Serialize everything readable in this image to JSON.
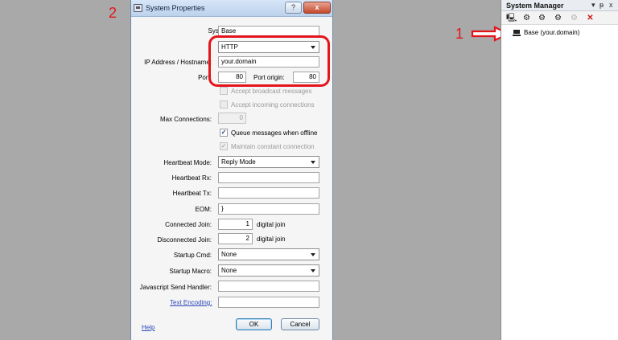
{
  "annotations": {
    "label_1": "1",
    "label_2": "2"
  },
  "dialog": {
    "title": "System Properties",
    "help_glyph": "?",
    "close_glyph": "x",
    "fields": {
      "system_name": {
        "label": "System Name:",
        "value": "Base"
      },
      "protocol": {
        "label": "Protocol:",
        "value": "HTTP"
      },
      "ip_address": {
        "label": "IP Address / Hostname:",
        "value": "your.domain"
      },
      "port": {
        "label": "Port:",
        "value": "80"
      },
      "port_origin": {
        "label": "Port origin:",
        "value": "80"
      },
      "accept_broadcast": {
        "label": "Accept broadcast messages",
        "checked": false,
        "enabled": false
      },
      "accept_incoming": {
        "label": "Accept incoming connections",
        "checked": false,
        "enabled": false
      },
      "max_connections": {
        "label": "Max Connections:",
        "value": "0"
      },
      "queue_messages": {
        "label": "Queue messages when offline",
        "checked": true,
        "enabled": true
      },
      "maintain_connection": {
        "label": "Maintain constant connection",
        "checked": true,
        "enabled": false
      },
      "heartbeat_mode": {
        "label": "Heartbeat Mode:",
        "value": "Reply Mode"
      },
      "heartbeat_rx": {
        "label": "Heartbeat Rx:",
        "value": ""
      },
      "heartbeat_tx": {
        "label": "Heartbeat Tx:",
        "value": ""
      },
      "eom": {
        "label": "EOM:",
        "value": "}"
      },
      "connected_join": {
        "label": "Connected Join:",
        "value": "1",
        "suffix": "digital join"
      },
      "disconnected_join": {
        "label": "Disconnected Join:",
        "value": "2",
        "suffix": "digital join"
      },
      "startup_cmd": {
        "label": "Startup Cmd:",
        "value": "None"
      },
      "startup_macro": {
        "label": "Startup Macro:",
        "value": "None"
      },
      "js_send_handler": {
        "label": "Javascript Send Handler:",
        "value": ""
      },
      "text_encoding": {
        "label": "Text Encoding:",
        "value": ""
      }
    },
    "help_link": "Help",
    "ok_label": "OK",
    "cancel_label": "Cancel",
    "checkmark": "✓"
  },
  "system_manager": {
    "title": "System Manager",
    "ctrl_dropdown": "▾",
    "ctrl_pin": "ᵽ",
    "ctrl_close": "x",
    "toolbar_icons": [
      "computer-icon",
      "gear-add-icon",
      "gear-multi-icon",
      "gear-edit-icon",
      "gear-disabled-icon",
      "delete-icon"
    ],
    "tree": [
      {
        "label": "Base (your.domain)"
      }
    ]
  },
  "colors": {
    "annotation_red": "#e4141b",
    "link_blue": "#2a47b6"
  }
}
